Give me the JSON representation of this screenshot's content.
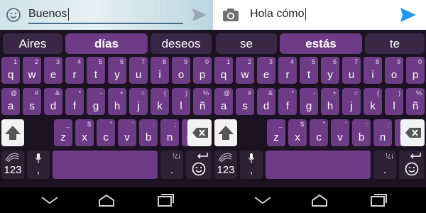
{
  "left_screen": {
    "compose_text": "Buenos",
    "suggestions": [
      "Aires",
      "días",
      "deseos"
    ],
    "row1": [
      {
        "k": "q",
        "a": "1"
      },
      {
        "k": "w",
        "a": "2"
      },
      {
        "k": "e",
        "a": "3"
      },
      {
        "k": "r",
        "a": "4"
      },
      {
        "k": "t",
        "a": "5"
      },
      {
        "k": "y",
        "a": "6"
      },
      {
        "k": "u",
        "a": "7"
      },
      {
        "k": "i",
        "a": "8"
      },
      {
        "k": "o",
        "a": "9"
      },
      {
        "k": "p",
        "a": "0"
      }
    ],
    "row2": [
      {
        "k": "a",
        "a": "@"
      },
      {
        "k": "s",
        "a": "#"
      },
      {
        "k": "d",
        "a": "&"
      },
      {
        "k": "f",
        "a": "*"
      },
      {
        "k": "g",
        "a": "-"
      },
      {
        "k": "h",
        "a": "+"
      },
      {
        "k": "j",
        "a": "="
      },
      {
        "k": "k",
        "a": "("
      },
      {
        "k": "l",
        "a": ")"
      },
      {
        "k": "ñ",
        "a": "%"
      }
    ],
    "row3": [
      {
        "k": "z",
        "a": "_"
      },
      {
        "k": "x",
        "a": "$"
      },
      {
        "k": "c",
        "a": "\""
      },
      {
        "k": "v",
        "a": "'"
      },
      {
        "k": "b",
        "a": ":"
      },
      {
        "k": "n",
        "a": ";"
      },
      {
        "k": "m",
        "a": "/"
      }
    ],
    "num_label": "123",
    "comma_label": ",",
    "period_label": ".",
    "period_alt": "!¿¡"
  },
  "right_screen": {
    "compose_text": "Hola cómo",
    "suggestions": [
      "se",
      "estás",
      "te"
    ],
    "row1": [
      {
        "k": "q",
        "a": "1"
      },
      {
        "k": "w",
        "a": "2"
      },
      {
        "k": "e",
        "a": "3"
      },
      {
        "k": "r",
        "a": "4"
      },
      {
        "k": "t",
        "a": "5"
      },
      {
        "k": "y",
        "a": "6"
      },
      {
        "k": "u",
        "a": "7"
      },
      {
        "k": "i",
        "a": "8"
      },
      {
        "k": "o",
        "a": "9"
      },
      {
        "k": "p",
        "a": "0"
      }
    ],
    "row2": [
      {
        "k": "a",
        "a": "@"
      },
      {
        "k": "s",
        "a": "#"
      },
      {
        "k": "d",
        "a": "&"
      },
      {
        "k": "f",
        "a": "*"
      },
      {
        "k": "g",
        "a": "-"
      },
      {
        "k": "h",
        "a": "+"
      },
      {
        "k": "j",
        "a": "="
      },
      {
        "k": "k",
        "a": "("
      },
      {
        "k": "l",
        "a": ")"
      },
      {
        "k": "ñ",
        "a": "%"
      }
    ],
    "row3": [
      {
        "k": "z",
        "a": "_"
      },
      {
        "k": "x",
        "a": "$"
      },
      {
        "k": "c",
        "a": "\""
      },
      {
        "k": "v",
        "a": "'"
      },
      {
        "k": "b",
        "a": ":"
      },
      {
        "k": "n",
        "a": ";"
      },
      {
        "k": "m",
        "a": "/"
      }
    ],
    "num_label": "123",
    "comma_label": ",",
    "period_label": ".",
    "period_alt": "!¿¡"
  },
  "icons": {
    "emoji": "smiley-icon",
    "send": "send-icon",
    "camera": "camera-icon",
    "shift": "shift-icon",
    "backspace": "backspace-icon",
    "mic": "microphone-icon",
    "enter": "enter-icon",
    "emoji_key": "emoji-icon",
    "swiftkey": "swiftkey-logo-icon",
    "nav": [
      "back-icon",
      "home-icon",
      "recents-icon"
    ]
  },
  "colors": {
    "key": "#6e3c86",
    "key_dark": "#2d2233",
    "keyboard_bg": "#1b1321",
    "suggestion_primary": "#6e3b86",
    "send_active": "#2196f3",
    "send_inactive": "#9aa6ad"
  }
}
